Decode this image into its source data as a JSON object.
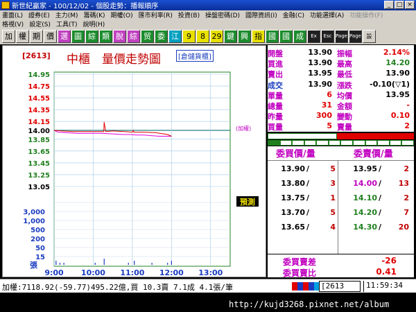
{
  "window": {
    "title": "新世紀贏家 - 100/12/02 - 個股走勢：播報順序",
    "controls": [
      "_",
      "□",
      "×"
    ]
  },
  "menu": {
    "row1": [
      "畫面(L)",
      "證券(E)",
      "主力(M)",
      "籌碼(K)",
      "期權(O)",
      "匯市利率(R)",
      "投資(B)",
      "操盤密碼(D)",
      "國際資訊(I)",
      "金融(C)",
      "功能選擇(A)",
      "功能操作(F)"
    ],
    "row2": [
      "格視(V)",
      "設定(S)",
      "工具(T)",
      "說明(H)"
    ]
  },
  "toolbar": [
    "加",
    "權",
    "期",
    "價",
    "選",
    "圖",
    "綜",
    "類",
    "脫",
    "綜",
    "贸",
    "委",
    "江",
    "9",
    "8",
    "29",
    "鍵",
    "興",
    "指",
    "國",
    "國",
    "成",
    "Ex",
    "Esc",
    "Page",
    "Page",
    "設"
  ],
  "chart": {
    "stock_code": "[2613]",
    "title": "中櫃　量價走勢圖",
    "storage_tag": "[倉儲貨櫃]",
    "ref_label": "(加權)",
    "flag_label": "預測"
  },
  "chart_data": {
    "type": "line",
    "price_axis": {
      "ticks": [
        "14.95",
        "14.75",
        "14.55",
        "14.35",
        "14.15",
        "14.00",
        "13.85",
        "13.65",
        "13.45",
        "13.25",
        "13.05"
      ],
      "tick_colors": [
        "#208020",
        "#e00000",
        "#e00000",
        "#e00000",
        "#e00000",
        "#000000",
        "#208020",
        "#208020",
        "#208020",
        "#208020",
        "#000000"
      ],
      "range": [
        13.05,
        14.95
      ],
      "reference": 14.0
    },
    "volume_axis": {
      "ticks": [
        "3,000",
        "1,000",
        "500",
        "200",
        "50",
        "15"
      ],
      "unit": "張"
    },
    "x_ticks": [
      "9:00",
      "10:00",
      "11:00",
      "12:00",
      "13:00"
    ],
    "series": [
      {
        "color": "#e000e0",
        "x": [
          9.0,
          9.1,
          9.3,
          9.6,
          9.9,
          10.2,
          10.5,
          10.75,
          10.95,
          11.1,
          11.3,
          11.5,
          11.7,
          11.85,
          12.0
        ],
        "y": [
          14.0,
          13.97,
          13.96,
          13.95,
          13.95,
          13.95,
          13.94,
          13.93,
          13.93,
          13.92,
          13.92,
          13.91,
          13.9,
          13.9,
          13.9
        ]
      },
      {
        "color": "#e00000",
        "x": [
          9.0,
          9.2,
          9.5,
          9.8,
          10.1,
          10.27,
          10.28,
          10.32,
          10.5,
          10.8,
          11.0,
          11.02,
          11.04,
          11.3,
          11.6,
          11.9,
          12.0
        ],
        "y": [
          14.0,
          13.99,
          13.98,
          13.98,
          13.98,
          13.98,
          14.14,
          13.98,
          13.99,
          13.98,
          13.97,
          14.0,
          13.97,
          13.97,
          13.96,
          13.93,
          13.9
        ]
      }
    ],
    "volume": {
      "x": [
        9.05,
        9.15,
        9.25,
        10.05,
        10.28,
        10.9,
        11.05,
        11.5,
        11.9,
        12.0
      ],
      "y": [
        2,
        1,
        1,
        1,
        3,
        1,
        2,
        1,
        1,
        2
      ]
    }
  },
  "quote": {
    "rows": [
      {
        "k1": "開盤",
        "v1": "13.90",
        "v1c": "#000000",
        "k2": "振幅",
        "v2": "2.14%",
        "v2c": "#e00000"
      },
      {
        "k1": "買進",
        "v1": "13.90",
        "v1c": "#000000",
        "k2": "最高",
        "v2": "14.20",
        "v2c": "#208020"
      },
      {
        "k1": "賣出",
        "v1": "13.95",
        "v1c": "#000000",
        "k2": "最低",
        "v2": "13.90",
        "v2c": "#000000"
      },
      {
        "k1": "成交",
        "v1": "13.90",
        "v1c": "#000000",
        "k2": "漲跌",
        "v2": "-0.10(▽1)",
        "v2c": "#000000"
      },
      {
        "k1": "單量",
        "v1": "6",
        "v1c": "#e00000",
        "k2": "均價",
        "v2": "13.95",
        "v2c": "#000000"
      },
      {
        "k1": "總量",
        "v1": "31",
        "v1c": "#e00000",
        "k2": "金額",
        "v2": "-",
        "v2c": "#e00000"
      },
      {
        "k1": "昨量",
        "v1": "300",
        "v1c": "#e00000",
        "k2": "變動",
        "v2": "0.10",
        "v2c": "#e00000"
      },
      {
        "k1": "買量",
        "v1": "5",
        "v1c": "#e00000",
        "k2": "賣量",
        "v2": "2",
        "v2c": "#e00000"
      }
    ]
  },
  "book": {
    "bid_header": "委買價/量",
    "ask_header": "委賣價/量",
    "bids": [
      {
        "price": "13.90",
        "qty": "5",
        "pc": "#000000"
      },
      {
        "price": "13.80",
        "qty": "3",
        "pc": "#000000"
      },
      {
        "price": "13.75",
        "qty": "1",
        "pc": "#000000"
      },
      {
        "price": "13.70",
        "qty": "5",
        "pc": "#000000"
      },
      {
        "price": "13.65",
        "qty": "4",
        "pc": "#000000"
      }
    ],
    "asks": [
      {
        "price": "13.95",
        "qty": "2",
        "pc": "#000000"
      },
      {
        "price": "14.00",
        "qty": "13",
        "pc": "#c000c0"
      },
      {
        "price": "14.10",
        "qty": "2",
        "pc": "#208020"
      },
      {
        "price": "14.20",
        "qty": "7",
        "pc": "#208020"
      },
      {
        "price": "14.30",
        "qty": "20",
        "pc": "#208020"
      }
    ],
    "summary": [
      {
        "label": "委買賣差",
        "value": "-26"
      },
      {
        "label": "委買賣比",
        "value": "0.41"
      }
    ]
  },
  "status": {
    "text": "加權:7118.92(-59.77)495.22億,買 10.3賣 7.1成 4.1張/筆",
    "code": "2613",
    "time": "11:59:34",
    "block_colors": [
      "#e00000",
      "#1a3cc0",
      "#e00000",
      "#1a3cc0",
      "#00a0e0"
    ]
  },
  "watermark": "http://kujd3268.pixnet.net/album"
}
